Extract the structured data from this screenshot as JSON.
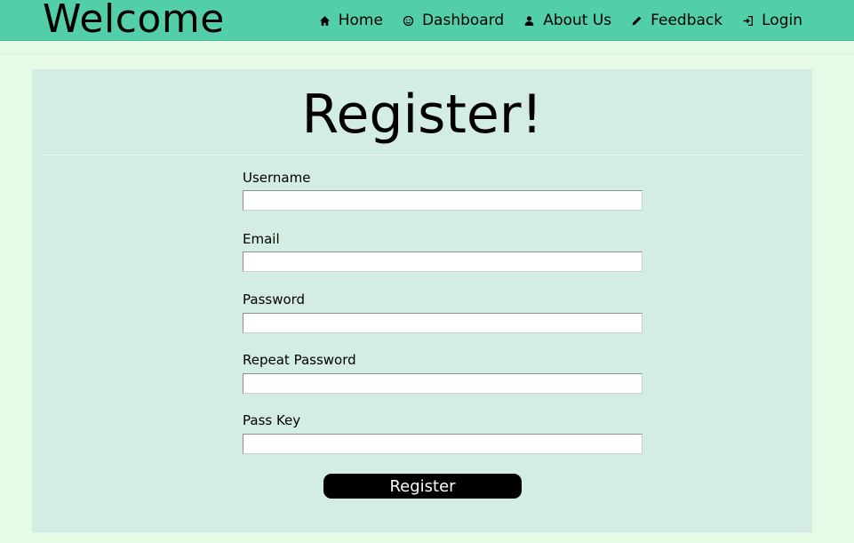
{
  "navbar": {
    "brand": "Welcome",
    "items": [
      {
        "label": "Home",
        "icon": "home-icon"
      },
      {
        "label": "Dashboard",
        "icon": "smiley-icon"
      },
      {
        "label": "About Us",
        "icon": "user-icon"
      },
      {
        "label": "Feedback",
        "icon": "pencil-icon"
      },
      {
        "label": "Login",
        "icon": "login-icon"
      }
    ],
    "color": "#52cfa8"
  },
  "form": {
    "title": "Register!",
    "fields": [
      {
        "label": "Username",
        "value": "",
        "placeholder": ""
      },
      {
        "label": "Email",
        "value": "",
        "placeholder": ""
      },
      {
        "label": "Password",
        "value": "",
        "placeholder": ""
      },
      {
        "label": "Repeat Password",
        "value": "",
        "placeholder": ""
      },
      {
        "label": "Pass Key",
        "value": "",
        "placeholder": ""
      }
    ],
    "submit_label": "Register"
  },
  "colors": {
    "page_background": "#e6fbe6",
    "panel_background": "#d3ede2",
    "button_background": "#000000"
  }
}
